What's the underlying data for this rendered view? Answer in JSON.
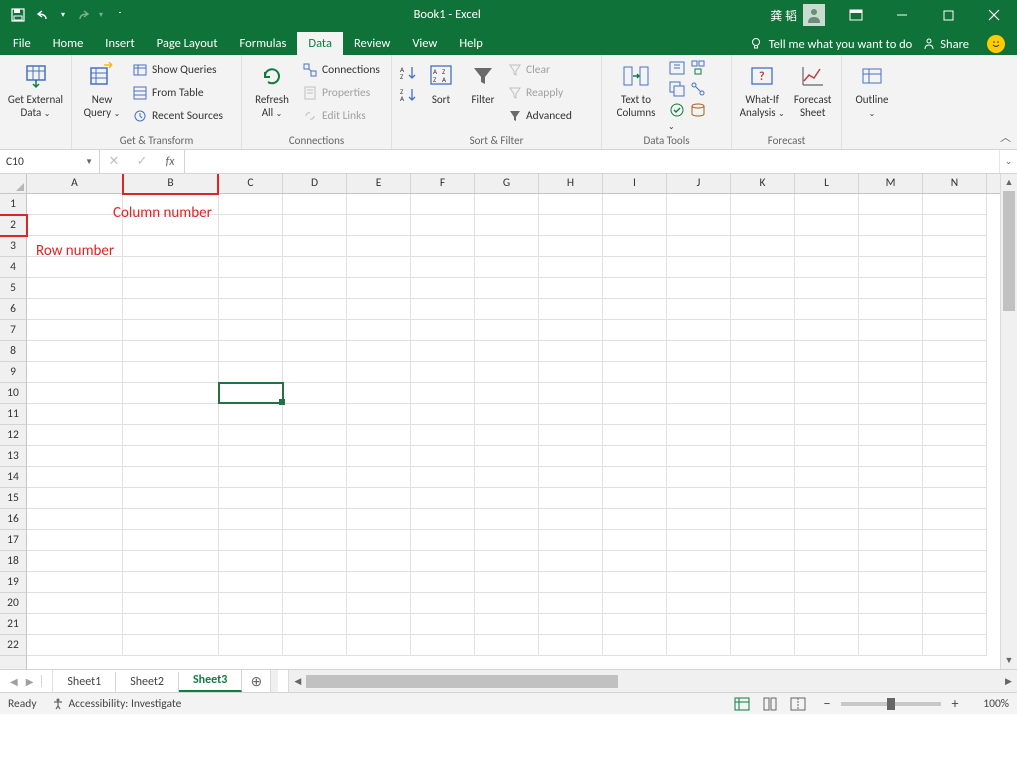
{
  "title": {
    "doc": "Book1",
    "sep": " - ",
    "app": "Excel"
  },
  "user": {
    "name": "龚 韬"
  },
  "qat": {
    "save": "💾",
    "undo": "↶",
    "redo": "↷"
  },
  "tabs": {
    "file": "File",
    "home": "Home",
    "insert": "Insert",
    "pagelayout": "Page Layout",
    "formulas": "Formulas",
    "data": "Data",
    "review": "Review",
    "view": "View",
    "help": "Help",
    "tell": "Tell me what you want to do",
    "share": "Share"
  },
  "ribbon": {
    "getexternal": {
      "label": "Get External\nData",
      "drop": "⌄"
    },
    "gettransform": {
      "newquery": "New\nQuery",
      "showqueries": "Show Queries",
      "fromtable": "From Table",
      "recentsources": "Recent Sources",
      "group": "Get & Transform"
    },
    "connections": {
      "refreshall": "Refresh\nAll",
      "connections": "Connections",
      "properties": "Properties",
      "editlinks": "Edit Links",
      "group": "Connections"
    },
    "sortfilter": {
      "sort": "Sort",
      "filter": "Filter",
      "clear": "Clear",
      "reapply": "Reapply",
      "advanced": "Advanced",
      "group": "Sort & Filter"
    },
    "datatools": {
      "texttocol": "Text to\nColumns",
      "group": "Data Tools"
    },
    "forecast": {
      "whatif": "What-If\nAnalysis",
      "sheet": "Forecast\nSheet",
      "group": "Forecast"
    },
    "outline": {
      "label": "Outline",
      "group": ""
    }
  },
  "namebox": "C10",
  "columns": [
    "A",
    "B",
    "C",
    "D",
    "E",
    "F",
    "G",
    "H",
    "I",
    "J",
    "K",
    "L",
    "M",
    "N"
  ],
  "rows": [
    "1",
    "2",
    "3",
    "4",
    "5",
    "6",
    "7",
    "8",
    "9",
    "10",
    "11",
    "12",
    "13",
    "14",
    "15",
    "16",
    "17",
    "18",
    "19",
    "20",
    "21",
    "22"
  ],
  "annot": {
    "col": "Column number",
    "row": "Row number"
  },
  "sheets": {
    "items": [
      "Sheet1",
      "Sheet2",
      "Sheet3"
    ],
    "active": "Sheet3"
  },
  "status": {
    "ready": "Ready",
    "acc": "Accessibility: Investigate",
    "zoom": "100%"
  }
}
